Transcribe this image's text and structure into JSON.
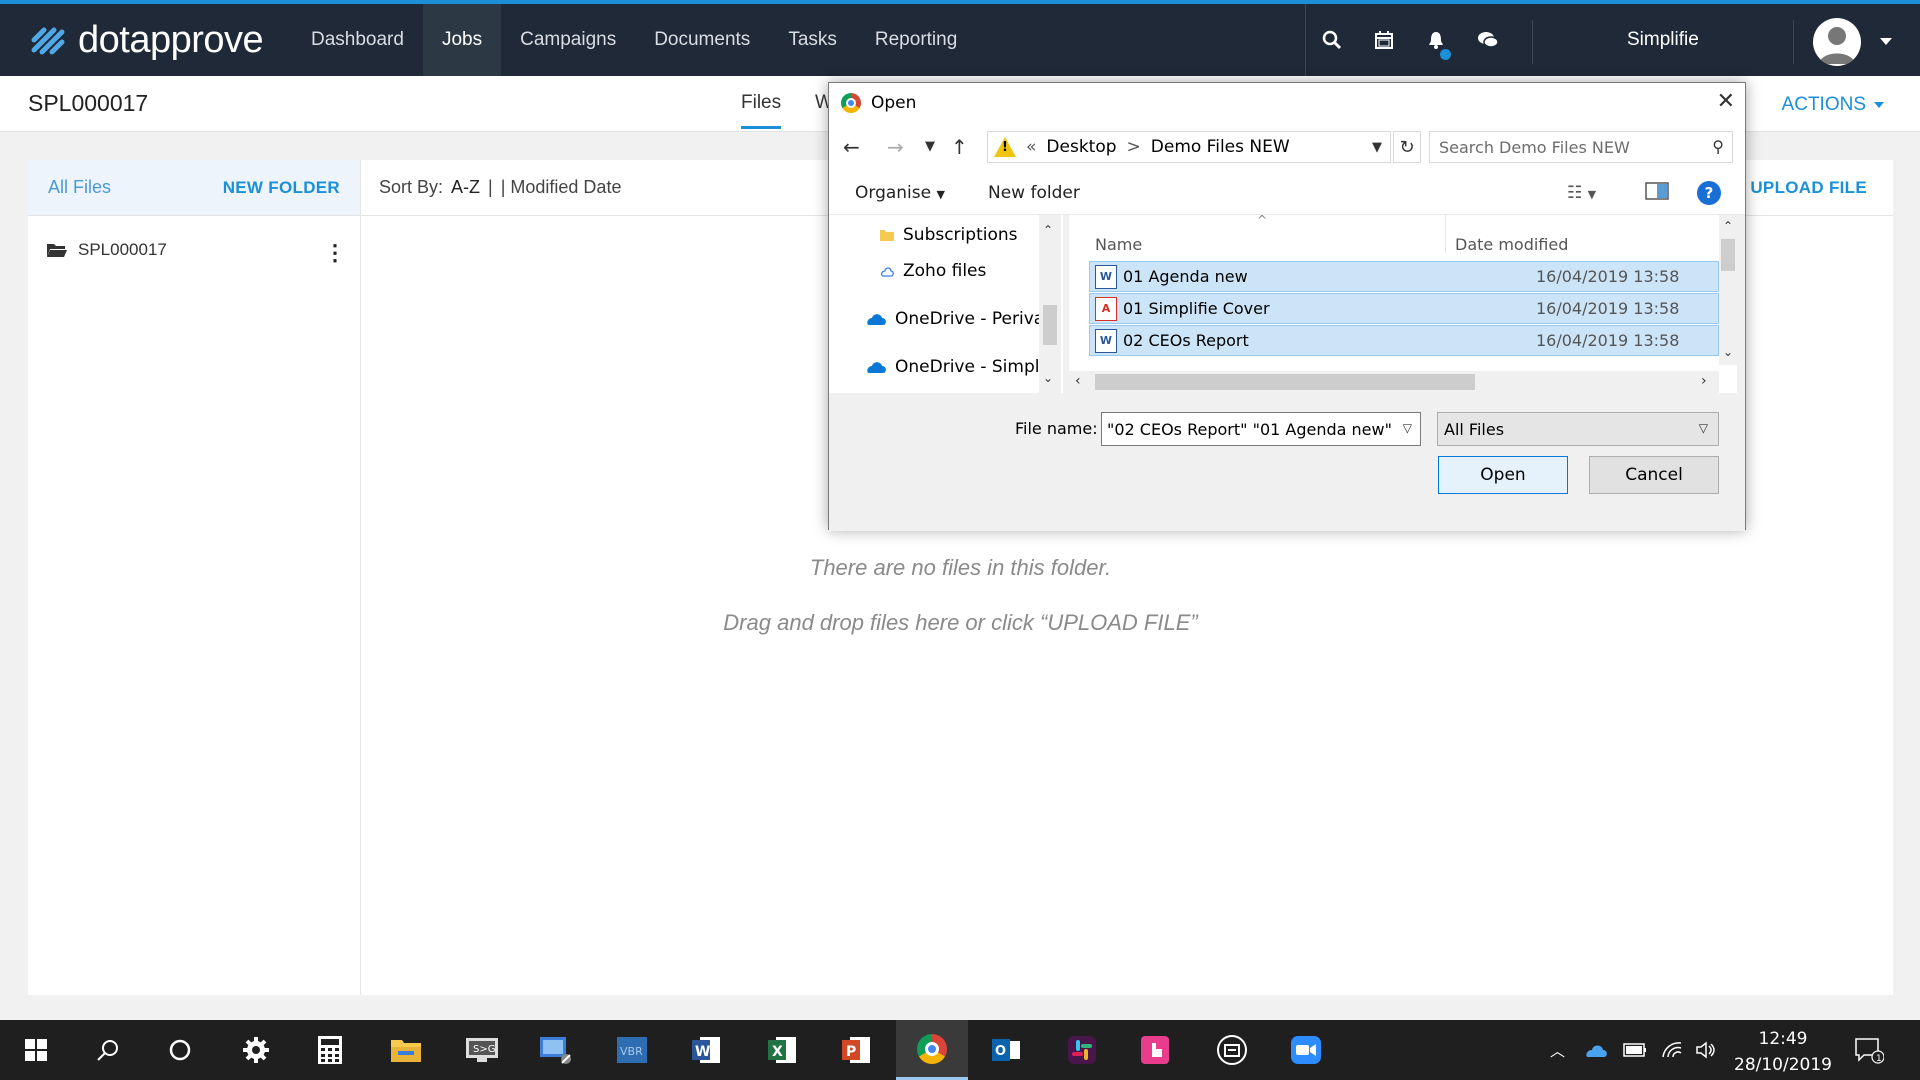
{
  "brand": {
    "name": "dotapprove"
  },
  "nav": {
    "items": [
      "Dashboard",
      "Jobs",
      "Campaigns",
      "Documents",
      "Tasks",
      "Reporting"
    ],
    "active": "Jobs",
    "user": "Simplifie"
  },
  "job": {
    "id": "SPL000017",
    "tabs": [
      "Files",
      "W"
    ],
    "actions_label": "ACTIONS"
  },
  "files_panel": {
    "all_files": "All Files",
    "new_folder": "NEW FOLDER",
    "folder_name": "SPL000017",
    "sort_by_label": "Sort By:",
    "sort_az": "A-Z",
    "sort_sep": "|",
    "sort_modified": "| Modified Date",
    "upload_label": "UPLOAD FILE",
    "empty_line1": "There are no files in this folder.",
    "empty_line2": "Drag and drop files here or click “UPLOAD FILE”"
  },
  "dialog": {
    "title": "Open",
    "breadcrumb": [
      "«",
      "Desktop",
      ">",
      "Demo Files NEW"
    ],
    "search_placeholder": "Search Demo Files NEW",
    "organise": "Organise",
    "new_folder": "New folder",
    "tree": [
      "Subscriptions",
      "Zoho files",
      "OneDrive - Perivar",
      "OneDrive - Simplif"
    ],
    "columns": {
      "name": "Name",
      "date": "Date modified"
    },
    "files": [
      {
        "name": "01 Agenda new",
        "date": "16/04/2019 13:58",
        "type": "word"
      },
      {
        "name": "01 Simplifie Cover",
        "date": "16/04/2019 13:58",
        "type": "pdf"
      },
      {
        "name": "02 CEOs Report",
        "date": "16/04/2019 13:58",
        "type": "word"
      }
    ],
    "file_name_label": "File name:",
    "file_name_value": "\"02 CEOs Report\" \"01 Agenda new\"",
    "file_type": "All Files",
    "open_button": "Open",
    "cancel_button": "Cancel"
  },
  "taskbar": {
    "time": "12:49",
    "date": "28/10/2019",
    "notification_count": "1"
  },
  "colors": {
    "accent": "#1b8fd8",
    "nav_bg": "#1f2937",
    "selection": "#cce4f7"
  }
}
